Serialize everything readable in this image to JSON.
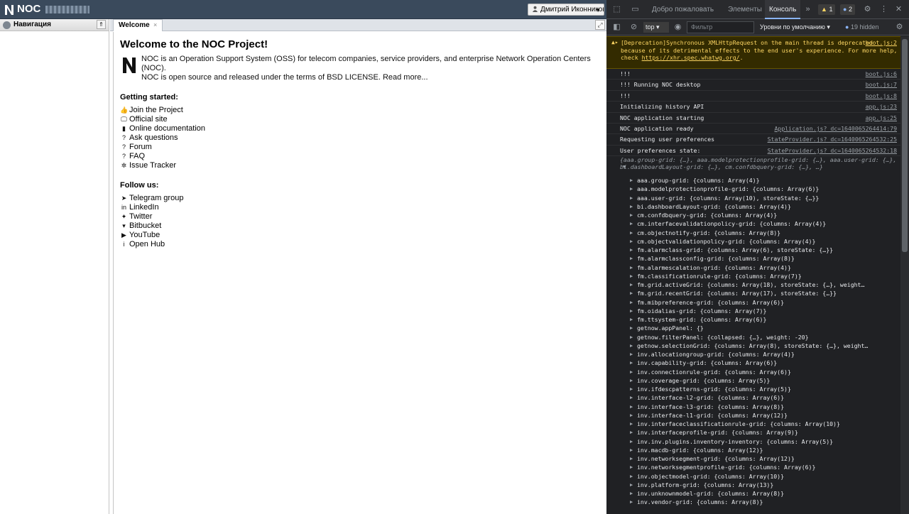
{
  "app": {
    "logo_text": "NOC",
    "user_label": "Дмитрий Иконников",
    "nav_title": "Навигация",
    "tab_label": "Welcome",
    "welcome_title": "Welcome to the NOC Project!",
    "intro_line1": "NOC is an Operation Support System (OSS) for telecom companies, service providers, and enterprise Network Operation Centers (NOC).",
    "intro_line2": "NOC is open source and released under the terms of BSD LICENSE. Read more...",
    "getting_started": "Getting started:",
    "links": [
      {
        "icon": "thumbs-up-icon",
        "glyph": "👍",
        "label": "Join the Project"
      },
      {
        "icon": "desktop-icon",
        "glyph": "🖵",
        "label": "Official site"
      },
      {
        "icon": "book-icon",
        "glyph": "▮",
        "label": "Online documentation"
      },
      {
        "icon": "question-icon",
        "glyph": "?",
        "label": "Ask questions"
      },
      {
        "icon": "question-icon",
        "glyph": "?",
        "label": "Forum"
      },
      {
        "icon": "question-icon",
        "glyph": "?",
        "label": "FAQ"
      },
      {
        "icon": "bug-icon",
        "glyph": "✲",
        "label": "Issue Tracker"
      }
    ],
    "follow_us": "Follow us:",
    "social": [
      {
        "icon": "telegram-icon",
        "glyph": "➤",
        "label": "Telegram group"
      },
      {
        "icon": "linkedin-icon",
        "glyph": "in",
        "label": "LinkedIn"
      },
      {
        "icon": "twitter-icon",
        "glyph": "✦",
        "label": "Twitter"
      },
      {
        "icon": "bitbucket-icon",
        "glyph": "▾",
        "label": "Bitbucket"
      },
      {
        "icon": "youtube-icon",
        "glyph": "▶",
        "label": "YouTube"
      },
      {
        "icon": "info-icon",
        "glyph": "i",
        "label": "Open Hub"
      }
    ]
  },
  "devtools": {
    "tabs": [
      "Добро пожаловать",
      "Элементы",
      "Консоль"
    ],
    "warning_count": "1",
    "info_count": "2",
    "context": "top",
    "filter_placeholder": "Фильтр",
    "levels": "Уровни по умолчанию",
    "hidden": "19 hidden",
    "warning": {
      "text": "[Deprecation]Synchronous XMLHttpRequest on the main thread is deprecated because of its detrimental effects to the end user's experience. For more help, check ",
      "link": "https://xhr.spec.whatwg.org/",
      "tail": ".",
      "source": "boot.js:2"
    },
    "logs": [
      {
        "text": "!!!",
        "source": "boot.js:6"
      },
      {
        "text": "!!! Running NOC desktop",
        "source": "boot.js:7"
      },
      {
        "text": "!!!",
        "source": "boot.js:8"
      },
      {
        "text": "Initializing history API",
        "source": "app.js:23"
      },
      {
        "text": "NOC application starting",
        "source": "app.js:25"
      },
      {
        "text": "NOC application ready",
        "source": "Application.js?_dc=1640065264414:79"
      },
      {
        "text": "Requesting user preferences",
        "source": "StateProvider.js?_dc=1640065264532:25"
      },
      {
        "text": "User preferences state:",
        "source": "StateProvider.js?_dc=1640065264532:18"
      }
    ],
    "summary": "{aaa.group-grid: {…}, aaa.modelprotectionprofile-grid: {…}, aaa.user-grid: {…}, bi.dashboardLayout-grid: {…}, cm.confdbquery-grid: {…}, …}",
    "props": [
      {
        "k": "aaa.group-grid",
        "v": "{columns: Array(4)}"
      },
      {
        "k": "aaa.modelprotectionprofile-grid",
        "v": "{columns: Array(6)}"
      },
      {
        "k": "aaa.user-grid",
        "v": "{columns: Array(10), storeState: {…}}"
      },
      {
        "k": "bi.dashboardLayout-grid",
        "v": "{columns: Array(4)}"
      },
      {
        "k": "cm.confdbquery-grid",
        "v": "{columns: Array(4)}"
      },
      {
        "k": "cm.interfacevalidationpolicy-grid",
        "v": "{columns: Array(4)}"
      },
      {
        "k": "cm.objectnotify-grid",
        "v": "{columns: Array(8)}"
      },
      {
        "k": "cm.objectvalidationpolicy-grid",
        "v": "{columns: Array(4)}"
      },
      {
        "k": "fm.alarmclass-grid",
        "v": "{columns: Array(6), storeState: {…}}"
      },
      {
        "k": "fm.alarmclassconfig-grid",
        "v": "{columns: Array(8)}"
      },
      {
        "k": "fm.alarmescalation-grid",
        "v": "{columns: Array(4)}"
      },
      {
        "k": "fm.classificationrule-grid",
        "v": "{columns: Array(7)}"
      },
      {
        "k": "fm.grid.activeGrid",
        "v": "{columns: Array(18), storeState: {…}, weight…"
      },
      {
        "k": "fm.grid.recentGrid",
        "v": "{columns: Array(17), storeState: {…}}"
      },
      {
        "k": "fm.mibpreference-grid",
        "v": "{columns: Array(6)}"
      },
      {
        "k": "fm.oidalias-grid",
        "v": "{columns: Array(7)}"
      },
      {
        "k": "fm.ttsystem-grid",
        "v": "{columns: Array(6)}"
      },
      {
        "k": "getnow.appPanel",
        "v": "{}"
      },
      {
        "k": "getnow.filterPanel",
        "v": "{collapsed: {…}, weight: -20}"
      },
      {
        "k": "getnow.selectionGrid",
        "v": "{columns: Array(8), storeState: {…}, weight…"
      },
      {
        "k": "inv.allocationgroup-grid",
        "v": "{columns: Array(4)}"
      },
      {
        "k": "inv.capability-grid",
        "v": "{columns: Array(6)}"
      },
      {
        "k": "inv.connectionrule-grid",
        "v": "{columns: Array(6)}"
      },
      {
        "k": "inv.coverage-grid",
        "v": "{columns: Array(5)}"
      },
      {
        "k": "inv.ifdescpatterns-grid",
        "v": "{columns: Array(5)}"
      },
      {
        "k": "inv.interface-l2-grid",
        "v": "{columns: Array(6)}"
      },
      {
        "k": "inv.interface-l3-grid",
        "v": "{columns: Array(8)}"
      },
      {
        "k": "inv.interface-l1-grid",
        "v": "{columns: Array(12)}"
      },
      {
        "k": "inv.interfaceclassificationrule-grid",
        "v": "{columns: Array(10)}"
      },
      {
        "k": "inv.interfaceprofile-grid",
        "v": "{columns: Array(9)}"
      },
      {
        "k": "inv.inv.plugins.inventory-inventory",
        "v": "{columns: Array(5)}"
      },
      {
        "k": "inv.macdb-grid",
        "v": "{columns: Array(12)}"
      },
      {
        "k": "inv.networksegment-grid",
        "v": "{columns: Array(12)}"
      },
      {
        "k": "inv.networksegmentprofile-grid",
        "v": "{columns: Array(6)}"
      },
      {
        "k": "inv.objectmodel-grid",
        "v": "{columns: Array(10)}"
      },
      {
        "k": "inv.platform-grid",
        "v": "{columns: Array(13)}"
      },
      {
        "k": "inv.unknownmodel-grid",
        "v": "{columns: Array(8)}"
      },
      {
        "k": "inv.vendor-grid",
        "v": "{columns: Array(8)}"
      }
    ]
  },
  "colors": {
    "topbar": "#3a4a5c",
    "devtools_bg": "#202124",
    "accent": "#8ab4f8"
  }
}
